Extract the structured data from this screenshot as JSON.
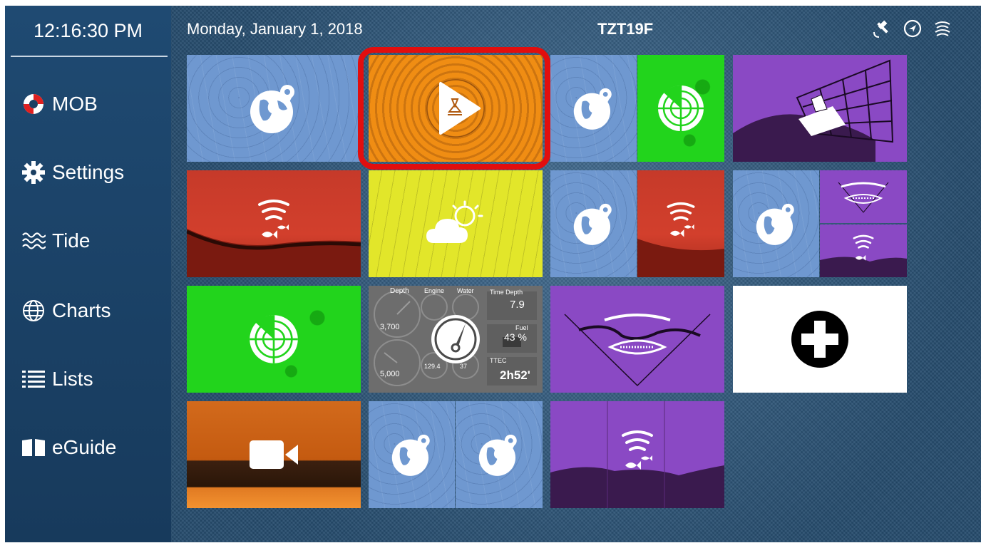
{
  "clock": "12:16:30 PM",
  "status_bar": {
    "date": "Monday, January 1, 2018",
    "model": "TZT19F",
    "icons": [
      "gps-satellite-icon",
      "navigation-arrow-icon",
      "signal-waves-icon"
    ]
  },
  "sidebar": {
    "items": [
      {
        "label": "MOB",
        "icon": "lifebuoy-icon"
      },
      {
        "label": "Settings",
        "icon": "gear-icon"
      },
      {
        "label": "Tide",
        "icon": "tide-waves-icon"
      },
      {
        "label": "Charts",
        "icon": "globe-icon"
      },
      {
        "label": "Lists",
        "icon": "list-icon"
      },
      {
        "label": "eGuide",
        "icon": "book-icon"
      }
    ]
  },
  "tiles": [
    {
      "name": "chart-plotter",
      "icons": [
        "globe-icon"
      ]
    },
    {
      "name": "radar-selected",
      "icons": [
        "radar-play-icon"
      ],
      "highlighted": true
    },
    {
      "name": "chart-radar-split",
      "icons": [
        "globe-icon",
        "radar-icon"
      ]
    },
    {
      "name": "3d-view",
      "icons": [
        "grid-3d-icon"
      ]
    },
    {
      "name": "fish-finder",
      "icons": [
        "fish-finder-icon"
      ]
    },
    {
      "name": "weather",
      "icons": [
        "weather-icon"
      ]
    },
    {
      "name": "chart-fishfinder-split",
      "icons": [
        "globe-icon",
        "fish-finder-icon"
      ]
    },
    {
      "name": "chart-sonar-split",
      "icons": [
        "globe-icon",
        "sonar-icon",
        "fish-finder-icon"
      ]
    },
    {
      "name": "radar",
      "icons": [
        "radar-icon"
      ]
    },
    {
      "name": "instruments",
      "icons": [
        "gauge-icon"
      ]
    },
    {
      "name": "sonar",
      "icons": [
        "sonar-icon"
      ]
    },
    {
      "name": "add-page",
      "icons": [
        "plus-icon"
      ]
    },
    {
      "name": "camera",
      "icons": [
        "video-camera-icon"
      ]
    },
    {
      "name": "dual-chart",
      "icons": [
        "globe-icon",
        "globe-icon"
      ]
    },
    {
      "name": "fish-finder-purple",
      "icons": [
        "fish-finder-icon"
      ]
    }
  ],
  "instrument_values": {
    "depth_label": "Depth",
    "time_depth_label": "Time Depth",
    "time_depth_value": "7.9",
    "fuel_label": "Fuel",
    "fuel_value": "43 %",
    "ttec_label": "TTEC",
    "ttec_value": "2h52'",
    "gauge1_value": "3,700",
    "gauge2_value": "5,000",
    "engine_label": "Engine",
    "water_label": "Water",
    "gauge3_value": "129.4",
    "gauge4_value": "37"
  },
  "colors": {
    "sidebar": "#1b3f62",
    "highlight": "#e20e0e",
    "chart": "#6f98d0",
    "sonar_red": "#c63a2a",
    "radar_green": "#22d41c",
    "purple": "#8a49c4",
    "weather_yellow": "#e2e62a",
    "radar_orange": "#f08d13"
  }
}
